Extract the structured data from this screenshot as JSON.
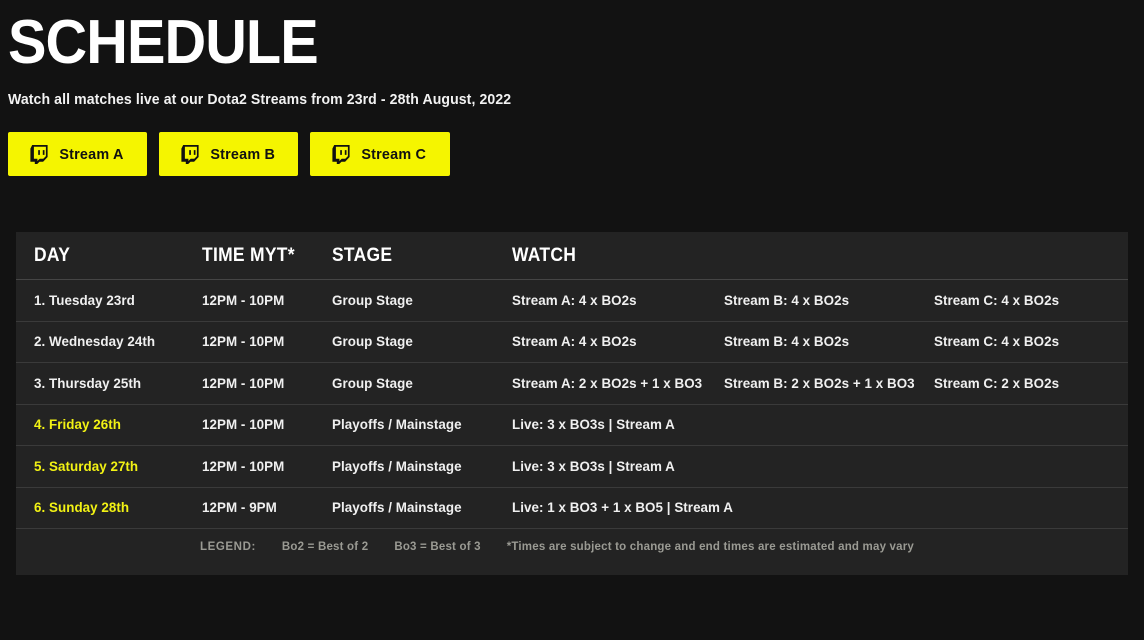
{
  "hero": {
    "title": "SCHEDULE",
    "subtitle": "Watch all matches live at our Dota2 Streams from 23rd - 28th August, 2022"
  },
  "stream_buttons": [
    {
      "label": "Stream A",
      "icon": "twitch-icon"
    },
    {
      "label": "Stream B",
      "icon": "twitch-icon"
    },
    {
      "label": "Stream C",
      "icon": "twitch-icon"
    }
  ],
  "colors": {
    "accent_yellow": "#f5f500",
    "highlight_text": "#f2f214",
    "page_background": "#121212",
    "panel_background": "#232323",
    "row_divider": "#3a3a3a"
  },
  "table": {
    "headers": {
      "day": "DAY",
      "time": "TIME MYT*",
      "stage": "STAGE",
      "watch": "WATCH"
    },
    "rows": [
      {
        "day": "1. Tuesday 23rd",
        "day_highlight": false,
        "time": "12PM - 10PM",
        "stage": "Group Stage",
        "watch_a": "Stream A: 4 x BO2s",
        "watch_b": "Stream B: 4 x BO2s",
        "watch_c": "Stream C: 4 x BO2s"
      },
      {
        "day": "2. Wednesday 24th",
        "day_highlight": false,
        "time": "12PM - 10PM",
        "stage": "Group Stage",
        "watch_a": "Stream A: 4 x BO2s",
        "watch_b": "Stream B: 4 x BO2s",
        "watch_c": "Stream C: 4 x BO2s"
      },
      {
        "day": "3. Thursday 25th",
        "day_highlight": false,
        "time": "12PM - 10PM",
        "stage": "Group Stage",
        "watch_a": "Stream A: 2 x BO2s + 1 x BO3",
        "watch_b": "Stream B: 2 x BO2s + 1 x BO3",
        "watch_c": "Stream C: 2 x BO2s"
      },
      {
        "day": "4. Friday 26th",
        "day_highlight": true,
        "time": "12PM - 10PM",
        "stage": "Playoffs / Mainstage",
        "watch_a": "Live: 3 x BO3s | Stream A",
        "watch_b": "",
        "watch_c": ""
      },
      {
        "day": "5. Saturday 27th",
        "day_highlight": true,
        "time": "12PM - 10PM",
        "stage": "Playoffs / Mainstage",
        "watch_a": "Live: 3 x BO3s | Stream A",
        "watch_b": "",
        "watch_c": ""
      },
      {
        "day": "6. Sunday 28th",
        "day_highlight": true,
        "time": "12PM - 9PM",
        "stage": "Playoffs / Mainstage",
        "watch_a": "Live: 1 x BO3 + 1 x BO5 | Stream A",
        "watch_b": "",
        "watch_c": ""
      }
    ]
  },
  "legend": {
    "title": "LEGEND:",
    "bo2": "Bo2 = Best of 2",
    "bo3": "Bo3 = Best of 3",
    "note": "*Times are subject to change and end times are estimated and may vary"
  }
}
